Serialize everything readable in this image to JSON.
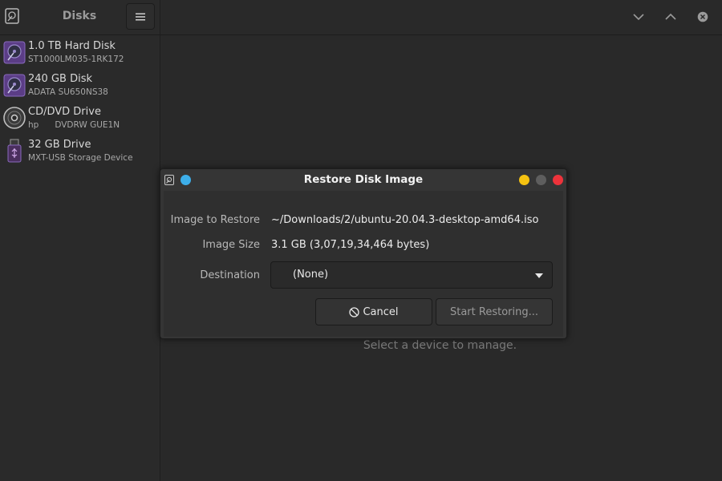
{
  "app": {
    "title": "Disks",
    "icon": "disks-app-icon"
  },
  "sidebar": {
    "menu_icon": "hamburger-menu-icon",
    "devices": [
      {
        "name": "1.0 TB Hard Disk",
        "detail": "ST1000LM035-1RK172",
        "icon": "hard-disk-icon"
      },
      {
        "name": "240 GB Disk",
        "detail": "ADATA SU650NS38",
        "icon": "hard-disk-icon"
      },
      {
        "name": "CD/DVD Drive",
        "detail": "hp      DVDRW GUE1N",
        "icon": "optical-drive-icon"
      },
      {
        "name": "32 GB Drive",
        "detail": "MXT-USB Storage Device",
        "icon": "usb-drive-icon"
      }
    ]
  },
  "main": {
    "empty_message": "Select a device to manage."
  },
  "window_controls": {
    "minimize": "chevron-down-icon",
    "maximize": "chevron-up-icon",
    "close": "close-icon"
  },
  "dialog": {
    "title": "Restore Disk Image",
    "image_label": "Image to Restore",
    "image_value": "~/Downloads/2/ubuntu-20.04.3-desktop-amd64.iso",
    "size_label": "Image Size",
    "size_value": "3.1 GB (3,07,19,34,464 bytes)",
    "destination_label": "Destination",
    "destination_value": "(None)",
    "cancel_label": "Cancel",
    "restore_label": "Start Restoring...",
    "controls": {
      "minimize_color": "#f5c211",
      "maximize_color": "#5e5e5e",
      "close_color": "#ed333b",
      "pin_color": "#3daee9"
    }
  },
  "colors": {
    "background": "#292929",
    "dialog": "#353535",
    "accent_purple": "#7a4fa6"
  }
}
